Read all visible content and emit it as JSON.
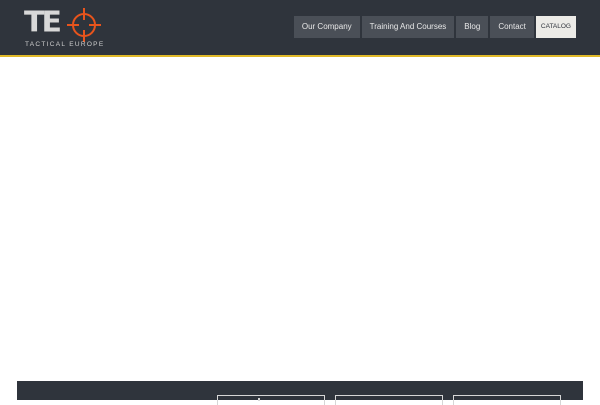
{
  "brand": {
    "logo_letters": "TE",
    "tagline": "TACTICAL EUROPE",
    "crosshair_color": "#e8541c"
  },
  "nav": {
    "items": [
      {
        "label": "Our Company"
      },
      {
        "label": "Training And Courses"
      },
      {
        "label": "Blog"
      },
      {
        "label": "Contact"
      },
      {
        "label": "CATALOG"
      }
    ]
  },
  "colors": {
    "header_bg": "#2f343c",
    "accent_line": "#e0b928",
    "nav_bg": "#4a4f57",
    "catalog_bg": "#ecebe7"
  },
  "footer": {
    "button_count_visible": 3
  }
}
